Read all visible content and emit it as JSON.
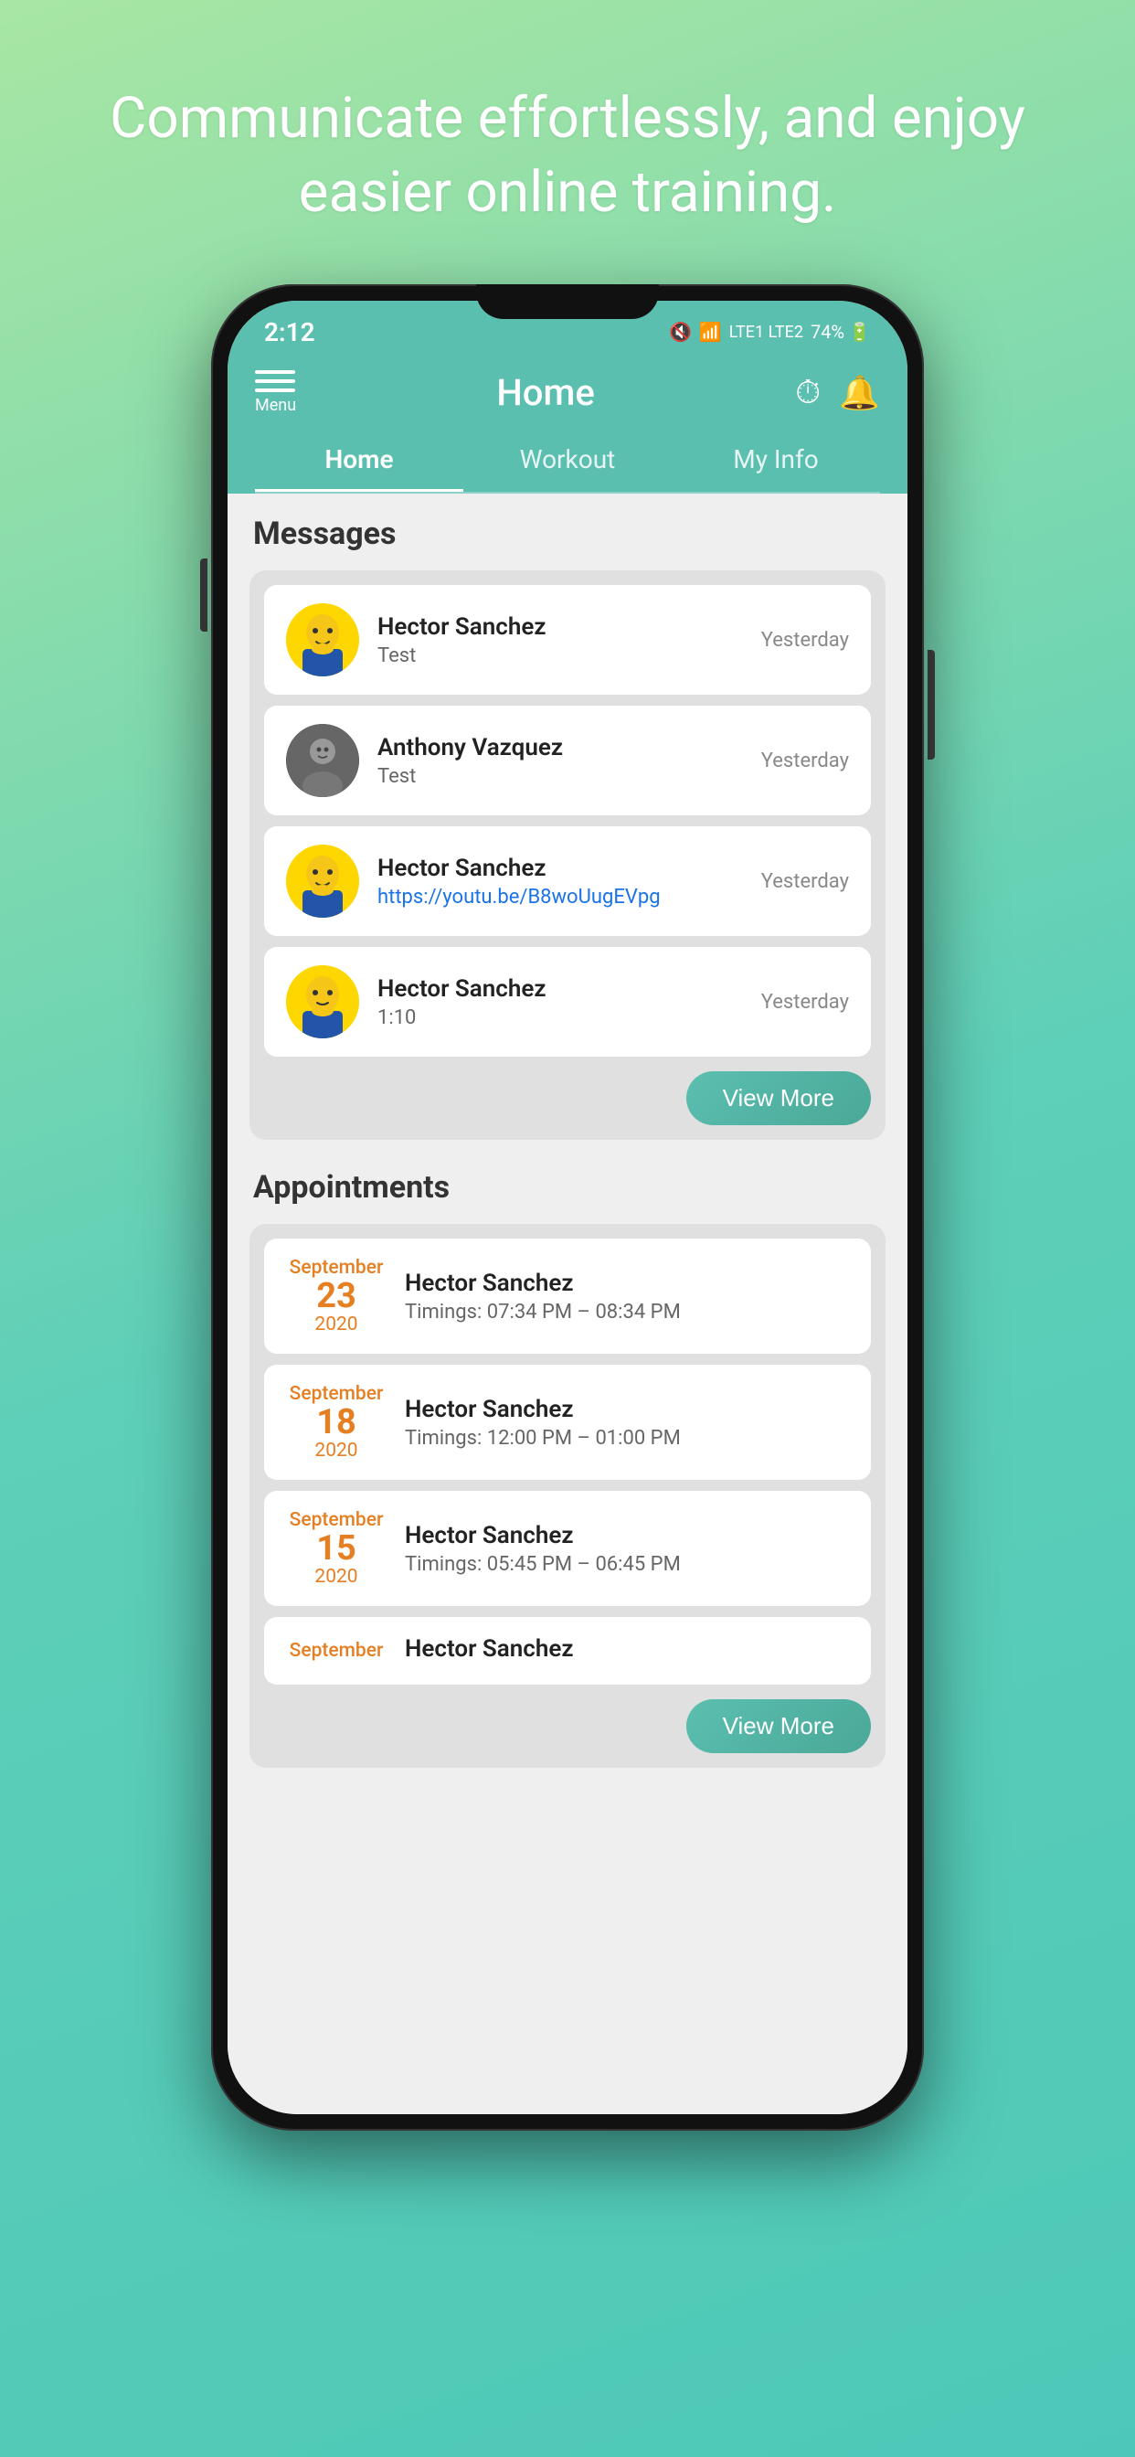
{
  "headline": {
    "line1": "Communicate effortlessly, and enjoy",
    "line2": "easier online training."
  },
  "statusBar": {
    "time": "2:12",
    "battery": "74%"
  },
  "appBar": {
    "menuLabel": "Menu",
    "title": "Home",
    "tabs": [
      {
        "label": "Home",
        "active": true
      },
      {
        "label": "Workout",
        "active": false
      },
      {
        "label": "My Info",
        "active": false
      }
    ]
  },
  "messages": {
    "sectionTitle": "Messages",
    "items": [
      {
        "name": "Hector Sanchez",
        "preview": "Test",
        "time": "Yesterday",
        "avatarType": "cartoon1"
      },
      {
        "name": "Anthony Vazquez",
        "preview": "Test",
        "time": "Yesterday",
        "avatarType": "photo"
      },
      {
        "name": "Hector Sanchez",
        "preview": "https://youtu.be/B8woUugEVpg",
        "time": "Yesterday",
        "avatarType": "cartoon1",
        "isLink": true
      },
      {
        "name": "Hector Sanchez",
        "preview": "1:10",
        "time": "Yesterday",
        "avatarType": "cartoon2"
      }
    ],
    "viewMoreLabel": "View More"
  },
  "appointments": {
    "sectionTitle": "Appointments",
    "items": [
      {
        "month": "September",
        "day": "23",
        "year": "2020",
        "name": "Hector Sanchez",
        "timings": "Timings: 07:34 PM – 08:34 PM"
      },
      {
        "month": "September",
        "day": "18",
        "year": "2020",
        "name": "Hector Sanchez",
        "timings": "Timings: 12:00 PM – 01:00 PM"
      },
      {
        "month": "September",
        "day": "15",
        "year": "2020",
        "name": "Hector Sanchez",
        "timings": "Timings: 05:45 PM – 06:45 PM"
      },
      {
        "month": "September",
        "day": "",
        "year": "",
        "name": "Hector Sanchez",
        "timings": ""
      }
    ],
    "viewMoreLabel": "View More"
  }
}
